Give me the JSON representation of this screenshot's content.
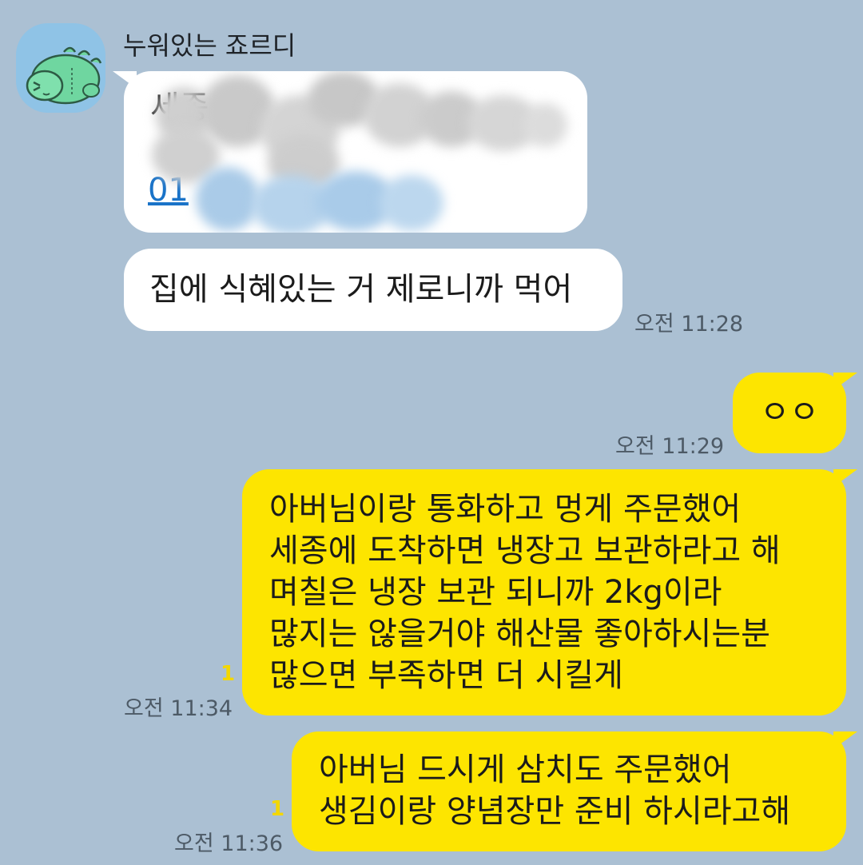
{
  "chat": {
    "sender_name": "누워있는 죠르디",
    "avatar_icon": "jordy-dinosaur-avatar-icon",
    "incoming": {
      "redacted_message": {
        "line1": "세종",
        "link_prefix": "01",
        "link_color": "#1a73c8",
        "is_blurred": true
      },
      "message2": {
        "text": "집에 식혜있는 거 제로니까 먹어",
        "time": "오전 11:28"
      }
    },
    "outgoing": [
      {
        "text": "ㅇㅇ",
        "time": "오전 11:29",
        "unread": ""
      },
      {
        "lines": [
          "아버님이랑 통화하고 멍게 주문했어",
          "세종에 도착하면 냉장고 보관하라고 해",
          "며칠은 냉장 보관 되니까 2kg이라",
          "많지는 않을거야 해산물 좋아하시는분",
          "많으면 부족하면 더 시킬게"
        ],
        "time": "오전 11:34",
        "unread": "1"
      },
      {
        "lines": [
          "아버님 드시게 삼치도 주문했어",
          "생김이랑 양념장만 준비 하시라고해"
        ],
        "time": "오전 11:36",
        "unread": "1"
      }
    ],
    "colors": {
      "background": "#abc0d3",
      "incoming_bubble": "#ffffff",
      "outgoing_bubble": "#fde500",
      "unread_count": "#f3d700",
      "timestamp": "#4d5a66"
    }
  }
}
